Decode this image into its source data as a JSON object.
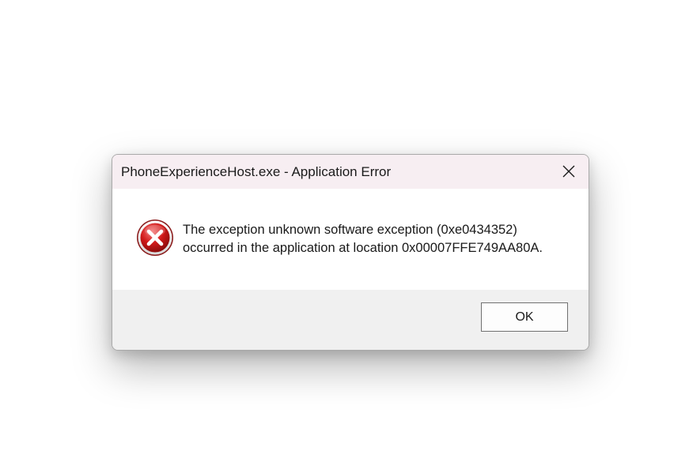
{
  "dialog": {
    "title": "PhoneExperienceHost.exe - Application Error",
    "icon": "error-x-icon",
    "message_line1": "The exception unknown software exception (0xe0434352)",
    "message_line2": "occurred in the application at location 0x00007FFE749AA80A.",
    "ok_label": "OK",
    "close_icon": "close-icon"
  },
  "colors": {
    "titlebar_bg": "#f7eef2",
    "content_bg": "#ffffff",
    "footer_bg": "#f0f0f0",
    "error_red": "#d01919"
  }
}
